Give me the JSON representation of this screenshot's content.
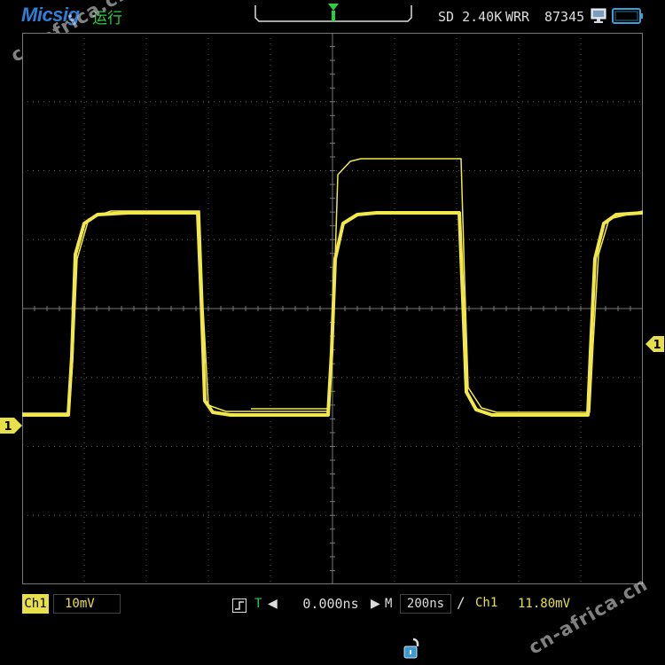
{
  "header": {
    "logo": "Micsig",
    "run_status": "运行",
    "sample_label": "SD 2.40K",
    "mode": "WRR",
    "memory": "87345"
  },
  "watermarks": [
    "cn-africa.cn",
    "cn-africa.cn"
  ],
  "markers": {
    "channel_marker": "1",
    "trigger_marker_top": "T"
  },
  "bottom": {
    "channel": "Ch1",
    "volts_div": "10mV",
    "trigger_t": "T",
    "delay": "0.000ns",
    "m_label": "M",
    "timebase": "200ns",
    "slope": "/",
    "trigger_source": "Ch1",
    "trigger_level": "11.80mV"
  },
  "colors": {
    "trace": "#f3e84a",
    "trigger": "#2ecc40",
    "logo": "#2f7fd6",
    "grid": "#5a5a5a"
  },
  "icons": {
    "trigger_bracket": "trigger-position-bracket-icon",
    "pc": "pc-connection-icon",
    "battery": "battery-icon",
    "trigger_mode": "trigger-mode-icon",
    "lock": "unlock-icon"
  }
}
